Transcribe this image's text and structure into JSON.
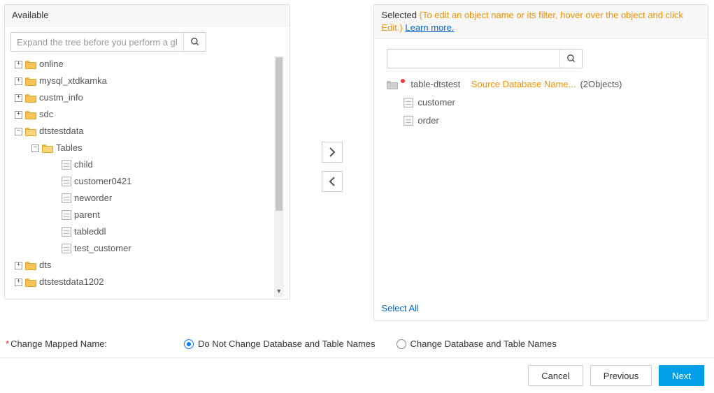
{
  "available": {
    "title": "Available",
    "search_placeholder": "Expand the tree before you perform a glo",
    "tree": [
      {
        "type": "db",
        "label": "online",
        "expanded": false
      },
      {
        "type": "db",
        "label": "mysql_xtdkamka",
        "expanded": false
      },
      {
        "type": "db",
        "label": "custm_info",
        "expanded": false
      },
      {
        "type": "db",
        "label": "sdc",
        "expanded": false
      },
      {
        "type": "db",
        "label": "dtstestdata",
        "expanded": true,
        "children": [
          {
            "type": "folder",
            "label": "Tables",
            "expanded": true,
            "children": [
              {
                "type": "table",
                "label": "child"
              },
              {
                "type": "table",
                "label": "customer0421"
              },
              {
                "type": "table",
                "label": "neworder"
              },
              {
                "type": "table",
                "label": "parent"
              },
              {
                "type": "table",
                "label": "tableddl"
              },
              {
                "type": "table",
                "label": "test_customer"
              }
            ]
          }
        ]
      },
      {
        "type": "db",
        "label": "dts",
        "expanded": false
      },
      {
        "type": "db",
        "label": "dtstestdata1202",
        "expanded": false
      }
    ]
  },
  "selected": {
    "title": "Selected",
    "hint": "(To edit an object name or its filter, hover over the object and click Edit.)",
    "learn_more": "Learn more.",
    "root_label": "table-dtstest",
    "root_note": "Source Database Name...",
    "root_count": "(2Objects)",
    "items": [
      {
        "type": "table",
        "label": "customer"
      },
      {
        "type": "table",
        "label": "order"
      }
    ],
    "select_all": "Select All"
  },
  "mapped": {
    "label": "Change Mapped Name:",
    "option_keep": "Do Not Change Database and Table Names",
    "option_change": "Change Database and Table Names"
  },
  "buttons": {
    "cancel": "Cancel",
    "previous": "Previous",
    "next": "Next"
  }
}
